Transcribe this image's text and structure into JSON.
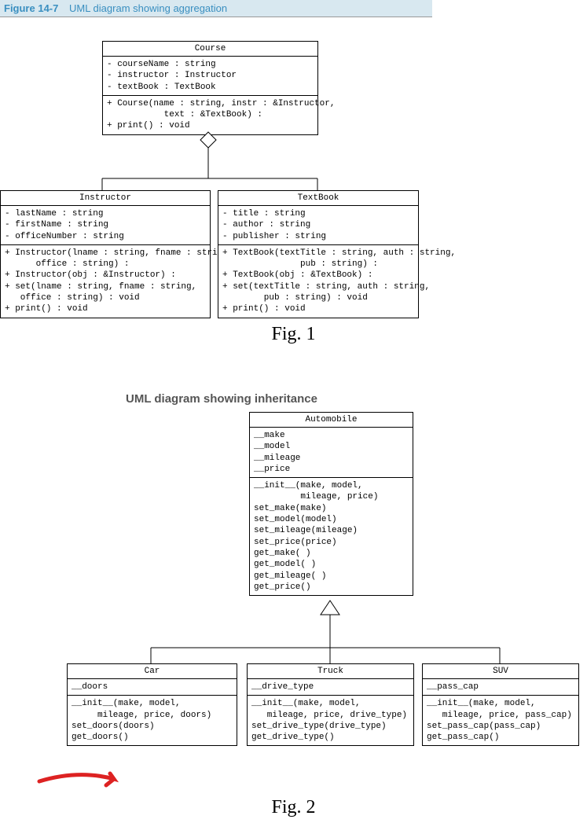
{
  "figure1": {
    "label": "Figure 14-7",
    "title": "UML diagram showing aggregation",
    "caption": "Fig. 1",
    "course": {
      "name": "Course",
      "attrs": "- courseName : string\n- instructor : Instructor\n- textBook : TextBook",
      "methods": "+ Course(name : string, instr : &Instructor,\n           text : &TextBook) :\n+ print() : void"
    },
    "instructor": {
      "name": "Instructor",
      "attrs": "- lastName : string\n- firstName : string\n- officeNumber : string",
      "methods": "+ Instructor(lname : string, fname : string,\n      office : string) :\n+ Instructor(obj : &Instructor) :\n+ set(lname : string, fname : string,\n   office : string) : void\n+ print() : void"
    },
    "textbook": {
      "name": "TextBook",
      "attrs": "- title : string\n- author : string\n- publisher : string",
      "methods": "+ TextBook(textTitle : string, auth : string,\n               pub : string) :\n+ TextBook(obj : &TextBook) :\n+ set(textTitle : string, auth : string,\n        pub : string) : void\n+ print() : void"
    }
  },
  "figure2": {
    "title": "UML diagram showing inheritance",
    "caption": "Fig. 2",
    "automobile": {
      "name": "Automobile",
      "attrs": "__make\n__model\n__mileage\n__price",
      "methods": "__init__(make, model,\n         mileage, price)\nset_make(make)\nset_model(model)\nset_mileage(mileage)\nset_price(price)\nget_make( )\nget_model( )\nget_mileage( )\nget_price()"
    },
    "car": {
      "name": "Car",
      "attrs": "__doors",
      "methods": "__init__(make, model,\n     mileage, price, doors)\nset_doors(doors)\nget_doors()"
    },
    "truck": {
      "name": "Truck",
      "attrs": "__drive_type",
      "methods": "__init__(make, model,\n   mileage, price, drive_type)\nset_drive_type(drive_type)\nget_drive_type()"
    },
    "suv": {
      "name": "SUV",
      "attrs": "__pass_cap",
      "methods": "__init__(make, model,\n   mileage, price, pass_cap)\nset_pass_cap(pass_cap)\nget_pass_cap()"
    }
  }
}
